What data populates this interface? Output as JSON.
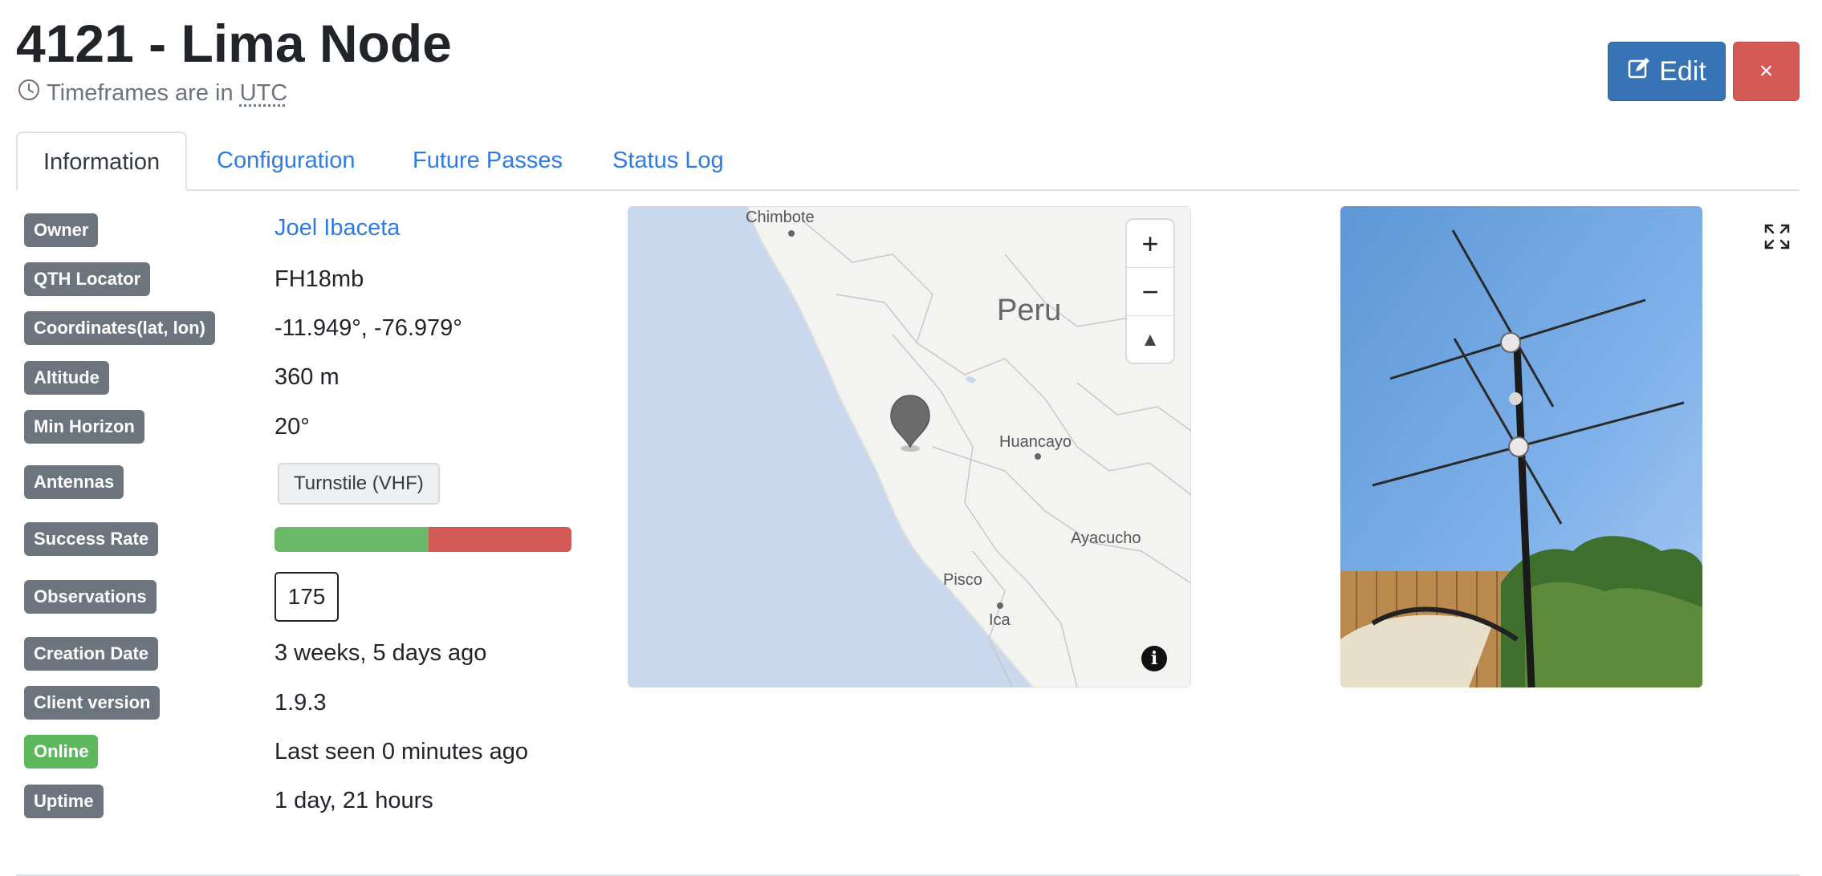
{
  "header": {
    "title": "4121 - Lima Node",
    "timezone_prefix": "Timeframes are in",
    "timezone": "UTC",
    "edit_label": "Edit",
    "close_label": "×"
  },
  "tabs": [
    {
      "label": "Information",
      "active": true
    },
    {
      "label": "Configuration",
      "active": false
    },
    {
      "label": "Future Passes",
      "active": false
    },
    {
      "label": "Status Log",
      "active": false
    }
  ],
  "info": {
    "owner": {
      "label": "Owner",
      "value": "Joel Ibaceta"
    },
    "qth": {
      "label": "QTH Locator",
      "value": "FH18mb"
    },
    "coords": {
      "label": "Coordinates(lat, lon)",
      "value": "-11.949°, -76.979°"
    },
    "altitude": {
      "label": "Altitude",
      "value": "360 m"
    },
    "horizon": {
      "label": "Min Horizon",
      "value": "20°"
    },
    "antennas": {
      "label": "Antennas",
      "value": "Turnstile (VHF)"
    },
    "success": {
      "label": "Success Rate",
      "good_fraction": 0.52
    },
    "observations": {
      "label": "Observations",
      "value": "175"
    },
    "created": {
      "label": "Creation Date",
      "value": "3 weeks, 5 days ago"
    },
    "client": {
      "label": "Client version",
      "value": "1.9.3"
    },
    "status": {
      "label": "Online",
      "value": "Last seen 0 minutes ago"
    },
    "uptime": {
      "label": "Uptime",
      "value": "1 day, 21 hours"
    }
  },
  "map": {
    "country_label": "Peru",
    "cities": [
      "Chimbote",
      "Huancayo",
      "Ayacucho",
      "Pisco",
      "Ica"
    ],
    "zoom_in": "+",
    "zoom_out": "−",
    "compass": "▲",
    "info": "i"
  },
  "colors": {
    "link": "#2f7be5",
    "badge": "#6c757d",
    "online": "#5cb85c",
    "success": "#6db96a",
    "fail": "#d45a56",
    "edit_button": "#3874b5",
    "close_button": "#d45a56"
  }
}
